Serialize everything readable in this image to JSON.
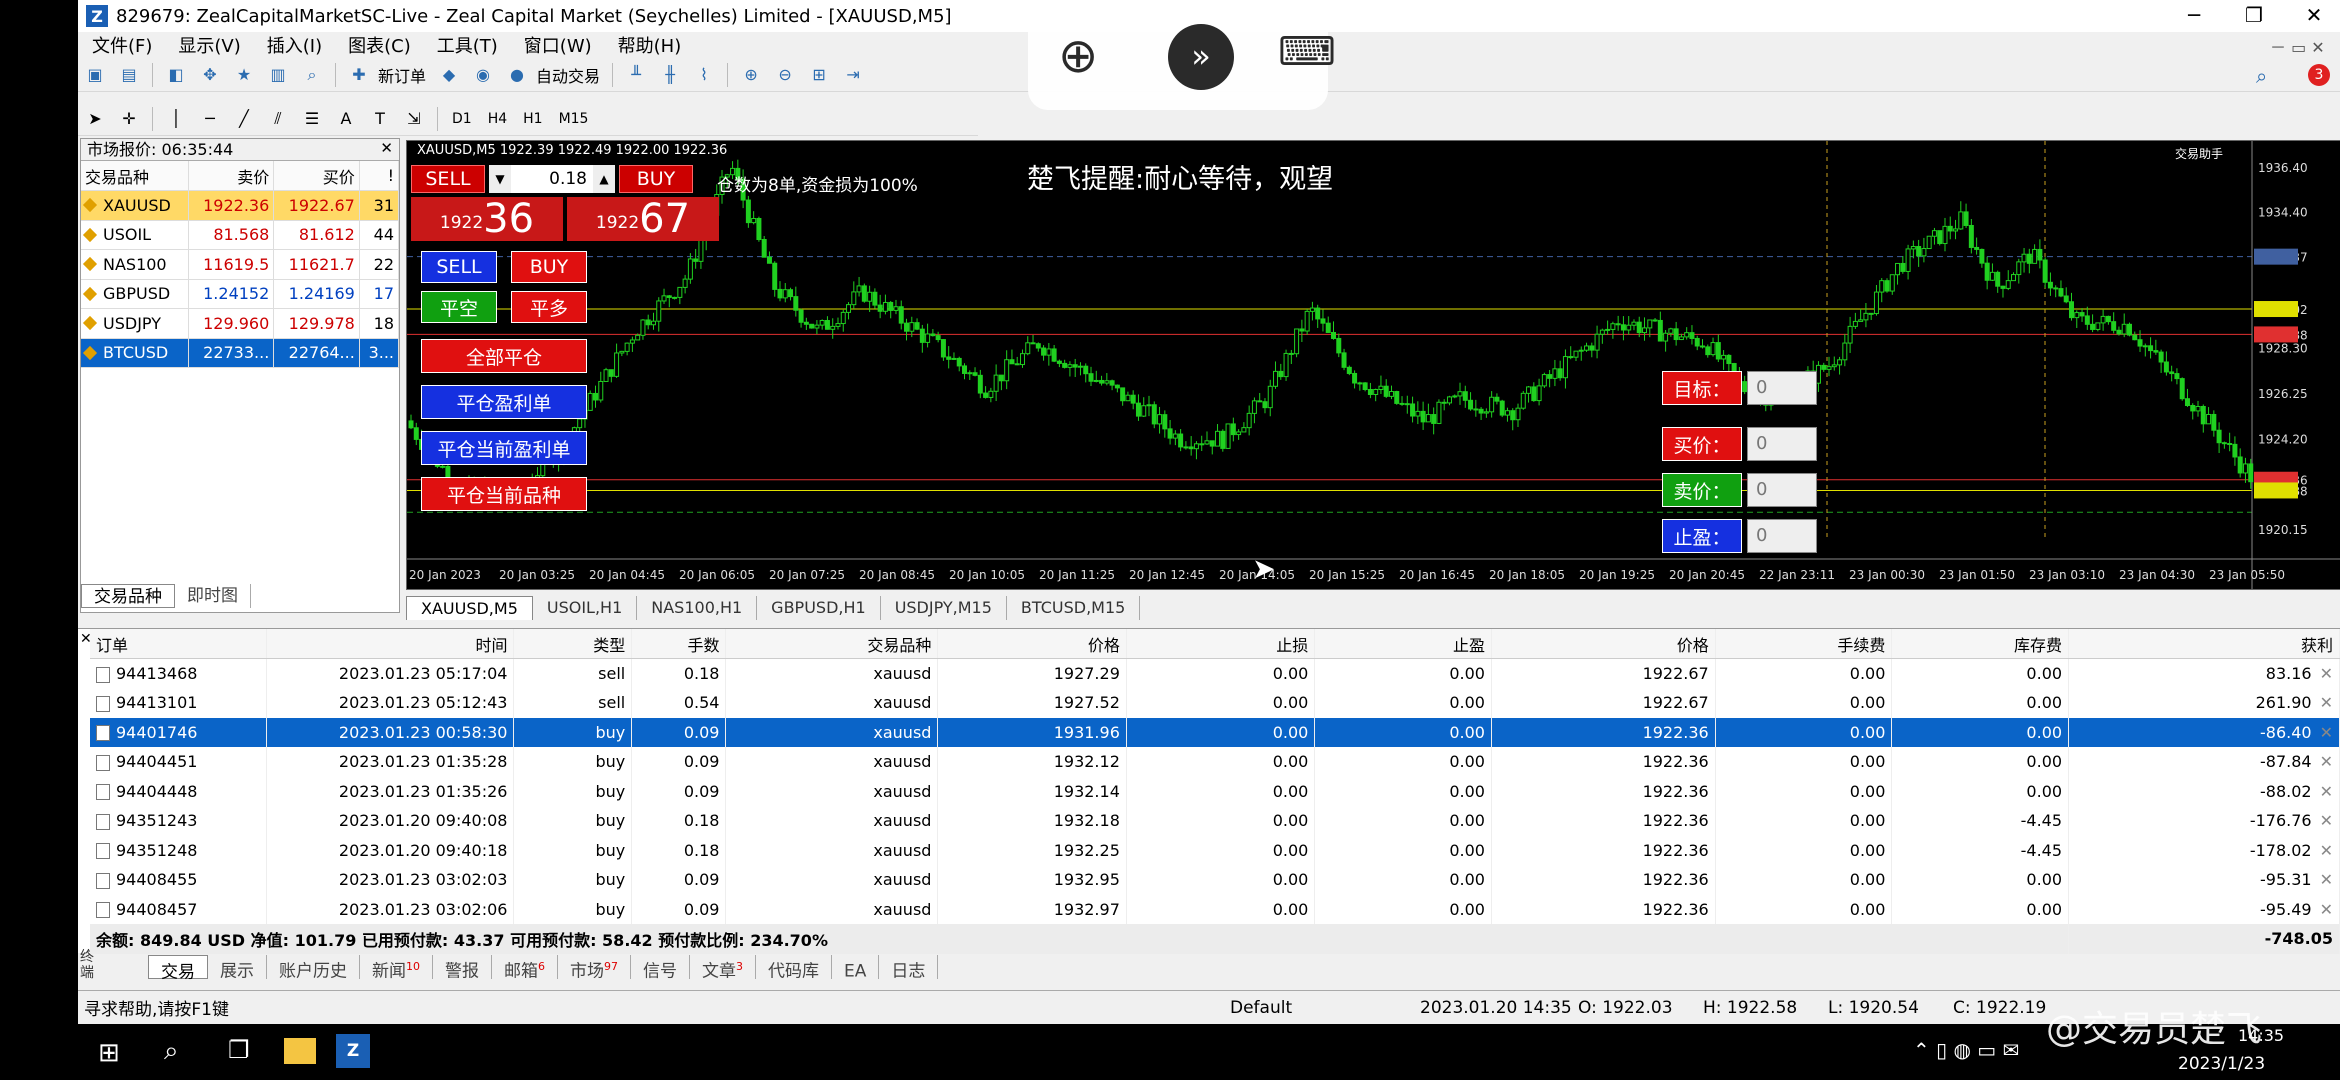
{
  "window": {
    "title": "829679: ZealCapitalMarketSC-Live - Zeal Capital Market (Seychelles) Limited - [XAUUSD,M5]"
  },
  "menu": [
    "文件(F)",
    "显示(V)",
    "插入(I)",
    "图表(C)",
    "工具(T)",
    "窗口(W)",
    "帮助(H)"
  ],
  "toolbar": {
    "new_order": "新订单",
    "auto_trade": "自动交易",
    "timeframes": [
      "D1",
      "H4",
      "H1",
      "M15"
    ],
    "notif_count": "3"
  },
  "market_watch": {
    "title": "市场报价: 06:35:44",
    "columns": [
      "交易品种",
      "卖价",
      "买价",
      "!"
    ],
    "rows": [
      {
        "symbol": "XAUUSD",
        "bid": "1922.36",
        "ask": "1922.67",
        "spread": "31",
        "bg": "#ffd966"
      },
      {
        "symbol": "USOIL",
        "bid": "81.568",
        "ask": "81.612",
        "spread": "44",
        "bg": "#ffffff"
      },
      {
        "symbol": "NAS100",
        "bid": "11619.5",
        "ask": "11621.7",
        "spread": "22",
        "bg": "#ffffff"
      },
      {
        "symbol": "GBPUSD",
        "bid": "1.24152",
        "ask": "1.24169",
        "spread": "17",
        "bg": "#ffffff"
      },
      {
        "symbol": "USDJPY",
        "bid": "129.960",
        "ask": "129.978",
        "spread": "18",
        "bg": "#ffffff"
      },
      {
        "symbol": "BTCUSD",
        "bid": "22733...",
        "ask": "22764...",
        "spread": "3...",
        "bg": "#0a64c8"
      }
    ],
    "tabs": [
      "交易品种",
      "即时图"
    ]
  },
  "chart": {
    "header": "XAUUSD,M5  1922.39 1922.49 1922.00 1922.36",
    "notice": "楚飞提醒:耐心等待，观望",
    "overlay_text": "仓数为8单,资金损为100%",
    "corner": "交易助手",
    "panel": {
      "sell": "SELL",
      "buy": "BUY",
      "lot": "0.18",
      "bid_small": "1922",
      "bid_big": "36",
      "ask_small": "1922",
      "ask_big": "67"
    },
    "buttons": {
      "sell2": "SELL",
      "buy2": "BUY",
      "close_short": "平空",
      "close_long": "平多",
      "close_all": "全部平仓",
      "close_profit": "平仓盈利单",
      "close_cur_profit": "平仓当前盈利单",
      "close_cur_symbol": "平仓当前品种"
    },
    "info": {
      "target_label": "目标：",
      "buy_label": "买价：",
      "sell_label": "卖价：",
      "tp_label": "止盈：",
      "value": "0"
    },
    "prices": [
      "1936.40",
      "1934.40",
      "1932.37",
      "1930.02",
      "1928.88",
      "1928.30",
      "1926.25",
      "1924.20",
      "1922.36",
      "1921.88",
      "1920.15"
    ],
    "times": [
      "20 Jan 2023",
      "20 Jan 03:25",
      "20 Jan 04:45",
      "20 Jan 06:05",
      "20 Jan 07:25",
      "20 Jan 08:45",
      "20 Jan 10:05",
      "20 Jan 11:25",
      "20 Jan 12:45",
      "20 Jan 14:05",
      "20 Jan 15:25",
      "20 Jan 16:45",
      "20 Jan 18:05",
      "20 Jan 19:25",
      "20 Jan 20:45",
      "22 Jan 23:11",
      "23 Jan 00:30",
      "23 Jan 01:50",
      "23 Jan 03:10",
      "23 Jan 04:30",
      "23 Jan 05:50"
    ]
  },
  "chart_tabs": [
    "XAUUSD,M5",
    "USOIL,H1",
    "NAS100,H1",
    "GBPUSD,H1",
    "USDJPY,M15",
    "BTCUSD,M15"
  ],
  "terminal": {
    "columns": [
      "订单",
      "时间",
      "类型",
      "手数",
      "交易品种",
      "价格",
      "止损",
      "止盈",
      "价格",
      "手续费",
      "库存费",
      "获利"
    ],
    "rows": [
      [
        "94413468",
        "2023.01.23 05:17:04",
        "sell",
        "0.18",
        "xauusd",
        "1927.29",
        "0.00",
        "0.00",
        "1922.67",
        "0.00",
        "0.00",
        "83.16"
      ],
      [
        "94413101",
        "2023.01.23 05:12:43",
        "sell",
        "0.54",
        "xauusd",
        "1927.52",
        "0.00",
        "0.00",
        "1922.67",
        "0.00",
        "0.00",
        "261.90"
      ],
      [
        "94401746",
        "2023.01.23 00:58:30",
        "buy",
        "0.09",
        "xauusd",
        "1931.96",
        "0.00",
        "0.00",
        "1922.36",
        "0.00",
        "0.00",
        "-86.40"
      ],
      [
        "94404451",
        "2023.01.23 01:35:28",
        "buy",
        "0.09",
        "xauusd",
        "1932.12",
        "0.00",
        "0.00",
        "1922.36",
        "0.00",
        "0.00",
        "-87.84"
      ],
      [
        "94404448",
        "2023.01.23 01:35:26",
        "buy",
        "0.09",
        "xauusd",
        "1932.14",
        "0.00",
        "0.00",
        "1922.36",
        "0.00",
        "0.00",
        "-88.02"
      ],
      [
        "94351243",
        "2023.01.20 09:40:08",
        "buy",
        "0.18",
        "xauusd",
        "1932.18",
        "0.00",
        "0.00",
        "1922.36",
        "0.00",
        "-4.45",
        "-176.76"
      ],
      [
        "94351248",
        "2023.01.20 09:40:18",
        "buy",
        "0.18",
        "xauusd",
        "1932.25",
        "0.00",
        "0.00",
        "1922.36",
        "0.00",
        "-4.45",
        "-178.02"
      ],
      [
        "94408455",
        "2023.01.23 03:02:03",
        "buy",
        "0.09",
        "xauusd",
        "1932.95",
        "0.00",
        "0.00",
        "1922.36",
        "0.00",
        "0.00",
        "-95.31"
      ],
      [
        "94408457",
        "2023.01.23 03:02:06",
        "buy",
        "0.09",
        "xauusd",
        "1932.97",
        "0.00",
        "0.00",
        "1922.36",
        "0.00",
        "0.00",
        "-95.49"
      ]
    ],
    "summary": "余额: 849.84 USD  净值: 101.79  已用预付款: 43.37  可用预付款: 58.42  预付款比例: 234.70%",
    "summary_profit": "-748.05",
    "side_label": "终端"
  },
  "bottom_tabs": [
    {
      "label": "交易",
      "badge": ""
    },
    {
      "label": "展示",
      "badge": ""
    },
    {
      "label": "账户历史",
      "badge": ""
    },
    {
      "label": "新闻",
      "badge": "10"
    },
    {
      "label": "警报",
      "badge": ""
    },
    {
      "label": "邮箱",
      "badge": "6"
    },
    {
      "label": "市场",
      "badge": "97"
    },
    {
      "label": "信号",
      "badge": ""
    },
    {
      "label": "文章",
      "badge": "3"
    },
    {
      "label": "代码库",
      "badge": ""
    },
    {
      "label": "EA",
      "badge": ""
    },
    {
      "label": "日志",
      "badge": ""
    }
  ],
  "status": {
    "help": "寻求帮助,请按F1键",
    "profile": "Default",
    "datetime": "2023.01.20 14:35",
    "open": "O: 1922.03",
    "high": "H: 1922.58",
    "low": "L: 1920.54",
    "close": "C: 1922.19"
  },
  "taskbar": {
    "time": "14:35",
    "date": "2023/1/23",
    "watermark": "@交易员楚飞"
  }
}
